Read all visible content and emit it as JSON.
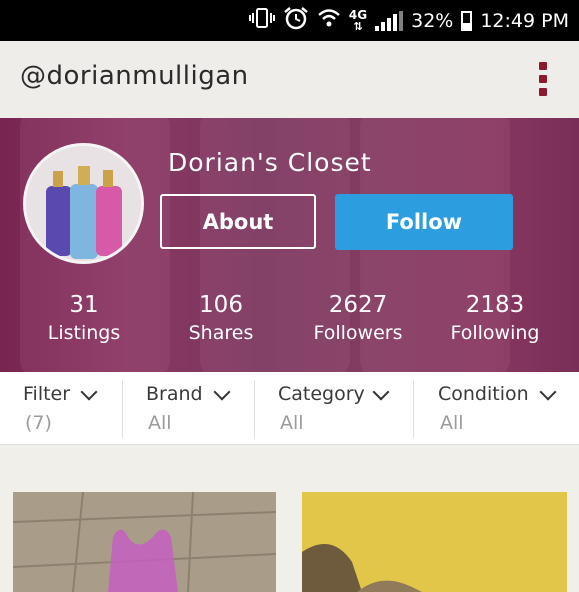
{
  "status_bar": {
    "network": "4G",
    "battery": "32%",
    "time": "12:49 PM",
    "icons": [
      "vibrate-icon",
      "alarm-icon",
      "wifi-icon",
      "network-4g-icon",
      "signal-icon",
      "battery-icon"
    ]
  },
  "header": {
    "handle": "@dorianmulligan",
    "menu_icon": "overflow-menu-icon",
    "accent": "#8b1a2e"
  },
  "profile": {
    "closet_title": "Dorian's Closet",
    "about_label": "About",
    "follow_label": "Follow",
    "follow_color": "#2c9ee0",
    "stats": [
      {
        "value": "31",
        "label": "Listings"
      },
      {
        "value": "106",
        "label": "Shares"
      },
      {
        "value": "2627",
        "label": "Followers"
      },
      {
        "value": "2183",
        "label": "Following"
      }
    ]
  },
  "filters": [
    {
      "label": "Filter",
      "value": "(7)"
    },
    {
      "label": "Brand",
      "value": "All"
    },
    {
      "label": "Category",
      "value": "All"
    },
    {
      "label": "Condition",
      "value": "All"
    }
  ]
}
